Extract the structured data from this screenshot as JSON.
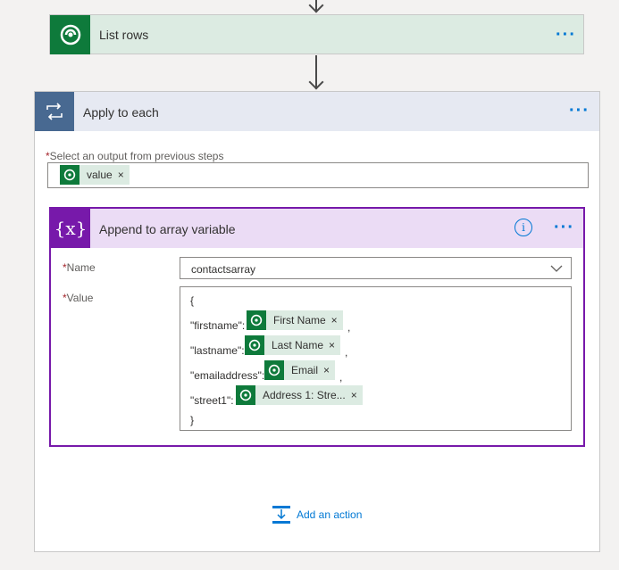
{
  "list_rows": {
    "title": "List rows",
    "more": "···"
  },
  "apply_each": {
    "title": "Apply to each",
    "more": "···",
    "select_label": "Select an output from previous steps",
    "required_mark": "*",
    "token_value": "value",
    "token_remove": "×"
  },
  "append": {
    "title": "Append to array variable",
    "info": "i",
    "more": "···",
    "icon_text": "{x}",
    "name_label": "Name",
    "name_value": "contactsarray",
    "value_label": "Value",
    "required_mark": "*",
    "lines": {
      "open": "{",
      "firstname_key": "\"firstname\":",
      "firstname_token": "First Name",
      "lastname_key": "\"lastname\":",
      "lastname_token": "Last Name",
      "email_key": "\"emailaddress\":",
      "email_token": "Email",
      "street_key": "\"street1\":",
      "street_token": "Address 1: Stre...",
      "comma": ",",
      "close": "}"
    },
    "token_remove": "×"
  },
  "add_action": {
    "label": "Add an action"
  },
  "colors": {
    "dataverse": "#0e7a3b",
    "loop": "#486991",
    "variable": "#7719aa",
    "link": "#0078d4"
  }
}
